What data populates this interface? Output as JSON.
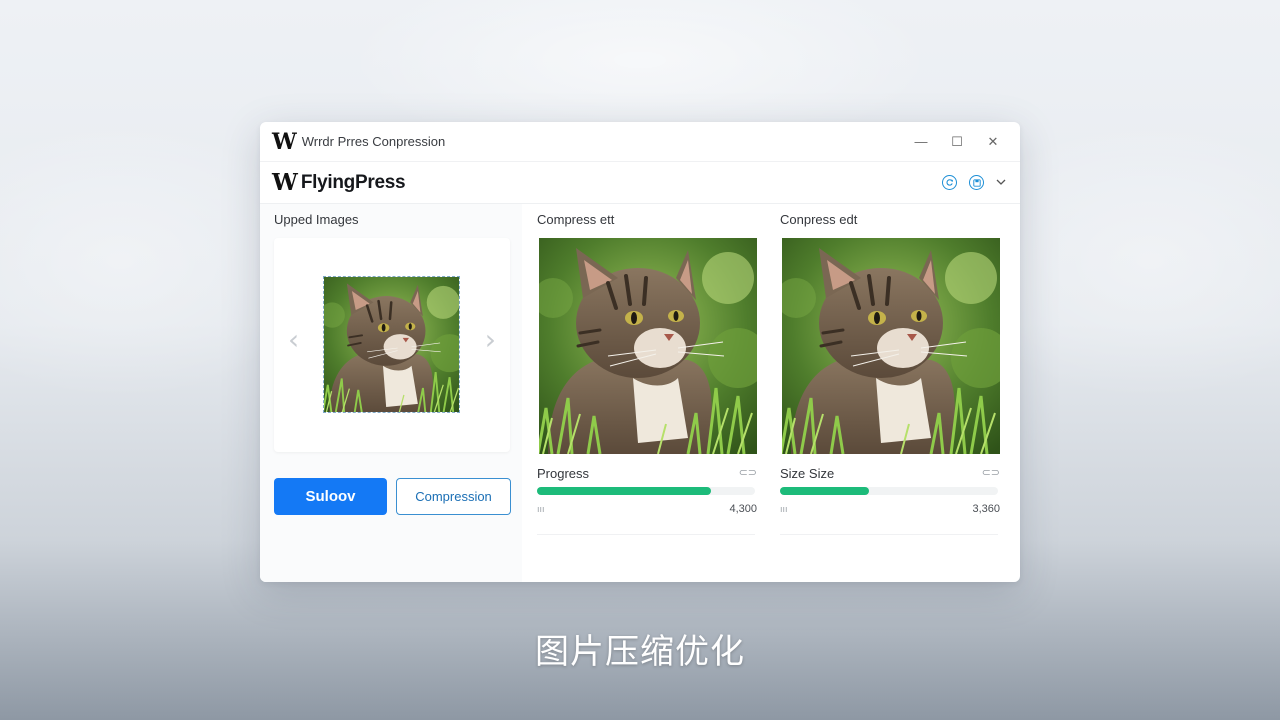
{
  "window": {
    "title": "Wrrdr Prres Conpression",
    "logo_letter": "W",
    "controls": {
      "minimize": "—",
      "maximize": "☐",
      "close": "✕"
    }
  },
  "appbar": {
    "logo_letter": "W",
    "brand": "FlyingPress",
    "icons": [
      "refresh-icon",
      "save-icon",
      "chevron-down-icon"
    ]
  },
  "left_panel": {
    "label": "Upped Images",
    "primary_button": "Suloov",
    "secondary_button": "Compression",
    "nav_prev": "‹",
    "nav_next": "›"
  },
  "columns": [
    {
      "label": "Compress ett",
      "progress_label": "Progress",
      "progress": 0.8,
      "small_left": "ııı",
      "value": "4,300"
    },
    {
      "label": "Conpress edt",
      "progress_label": "Size Size",
      "progress": 0.41,
      "small_left": "ııı",
      "value": "3,360"
    }
  ],
  "colors": {
    "accent": "#1479f5",
    "progress": "#1dbb7a",
    "icon": "#1d8fd6"
  },
  "caption": "图片压缩优化"
}
